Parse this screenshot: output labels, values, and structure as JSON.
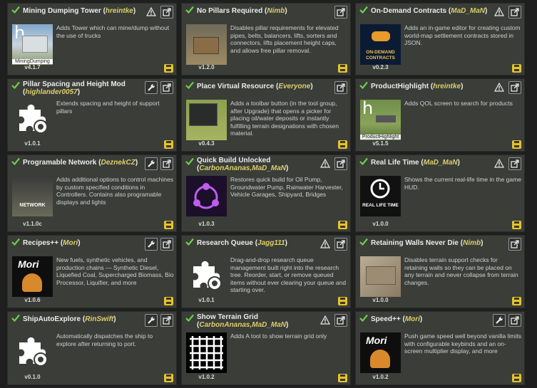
{
  "cards": [
    {
      "title": "Mining Dumping Tower",
      "author": "hreintke",
      "desc": "Adds Tower which can mine/dump without the use of trucks",
      "version": "v4.1.7",
      "thumb": "photo-mining",
      "thumb_text": "MiningDumping",
      "thumb_letter": "h",
      "warn": true,
      "wrench": false
    },
    {
      "title": "No Pillars Required",
      "author": "Nimb",
      "desc": "Disables pillar requirements for elevated pipes, belts, balancers, lifts, sorters and connectors, lifts placement height caps, and allows free pillar removal.",
      "version": "v1.2.0",
      "thumb": "photo-pillars",
      "thumb_text": "",
      "thumb_letter": "",
      "warn": false,
      "wrench": false
    },
    {
      "title": "On-Demand Contracts",
      "author": "MaD_MaN",
      "desc": "Adds an in-game editor for creating custom world-map settlement contracts stored in JSON.",
      "version": "v0.2.3",
      "thumb": "photo-contracts",
      "thumb_text": "ON-DEMAND CONTRACTS",
      "thumb_letter": "",
      "warn": true,
      "wrench": false
    },
    {
      "title": "Pillar Spacing and Height Mod",
      "author": "highlander0057",
      "desc": "Extends spacing and height of support pillars",
      "version": "v1.0.1",
      "thumb": "puzzle",
      "thumb_text": "",
      "thumb_letter": "",
      "warn": false,
      "wrench": true
    },
    {
      "title": "Place Virtual Resource",
      "author": "Everyone",
      "desc": "Adds a toolbar button (in the tool group, after Upgrade) that opens a picker for placing oil/water deposits or instantly fulfilling terrain designations with chosen material.",
      "version": "v0.4.3",
      "thumb": "photo-virtual",
      "thumb_text": "",
      "thumb_letter": "",
      "warn": false,
      "wrench": false
    },
    {
      "title": "ProductHighlight",
      "author": "hreintke",
      "desc": "Adds QOL screen to search for products",
      "version": "v5.1.5",
      "thumb": "photo-product",
      "thumb_text": "ProductHighlight",
      "thumb_letter": "h",
      "warn": true,
      "wrench": false
    },
    {
      "title": "Programable Network",
      "author": "DeznekCZ",
      "desc": "Adds additional options to control machines by custom specified conditions in Controllers. Contains also programable displays and lights",
      "version": "v1.1.0c",
      "thumb": "photo-network",
      "thumb_text": "NETWORK",
      "thumb_letter": "",
      "warn": false,
      "wrench": true
    },
    {
      "title": "Quick Build Unlocked",
      "author": "CarbonAnanas,MaD_MaN",
      "desc": "Restores quick build for Oil Pump, Groundwater Pump, Rainwater Harvester, Vehicle Garages, Shipyard, Bridges",
      "version": "v1.0.3",
      "thumb": "photo-quick",
      "thumb_text": "",
      "thumb_letter": "",
      "warn": true,
      "wrench": false
    },
    {
      "title": "Real Life Time",
      "author": "MaD_MaN",
      "desc": "Shows the current real-life time in the game HUD.",
      "version": "v1.0.0",
      "thumb": "photo-clock",
      "thumb_text": "REAL LIFE TIME",
      "thumb_letter": "",
      "warn": true,
      "wrench": false
    },
    {
      "title": "Recipes++",
      "author": "Mori",
      "desc": "New fuels, synthetic vehicles, and production chains — Synthetic Diesel, Liquefied Coal, Supercharged Biomass, Bio Processor, Liquifier, and more",
      "version": "v1.0.6",
      "thumb": "photo-mori",
      "thumb_text": "Mori",
      "thumb_letter": "",
      "warn": false,
      "wrench": true
    },
    {
      "title": "Research Queue",
      "author": "Jagg111",
      "desc": "Drag-and-drop research queue management built right into the research tree. Reorder, start, or remove queued items without ever clearing your queue and starting over.",
      "version": "v1.0.1",
      "thumb": "puzzle",
      "thumb_text": "",
      "thumb_letter": "",
      "warn": true,
      "wrench": false
    },
    {
      "title": "Retaining Walls Never Die",
      "author": "Nimb",
      "desc": "Disables terrain support checks for retaining walls so they can be placed on any terrain and never collapse from terrain changes.",
      "version": "v1.0.0",
      "thumb": "photo-walls",
      "thumb_text": "",
      "thumb_letter": "",
      "warn": false,
      "wrench": false
    },
    {
      "title": "ShipAutoExplore",
      "author": "RinSwift",
      "desc": "Automatically dispatches the ship to explore after returning to port.",
      "version": "v0.1.0",
      "thumb": "puzzle",
      "thumb_text": "",
      "thumb_letter": "",
      "warn": false,
      "wrench": true
    },
    {
      "title": "Show Terrain Grid",
      "author": "CarbonAnanas,MaD_MaN",
      "desc": "Adds A tool to show terrain grid only",
      "version": "v1.0.2",
      "thumb": "photo-grid",
      "thumb_text": "",
      "thumb_letter": "",
      "warn": true,
      "wrench": false
    },
    {
      "title": "Speed++",
      "author": "Mori",
      "desc": "Push game speed well beyond vanilla limits with configurable keybinds and an on-screen multiplier display, and more",
      "version": "v1.0.2",
      "thumb": "photo-mori",
      "thumb_text": "Mori",
      "thumb_letter": "",
      "warn": false,
      "wrench": true
    }
  ],
  "colors": {
    "card_bg": "#3a3d38",
    "author": "#ddcf6a",
    "check": "#6ccf4a",
    "save": "#e5c230"
  }
}
